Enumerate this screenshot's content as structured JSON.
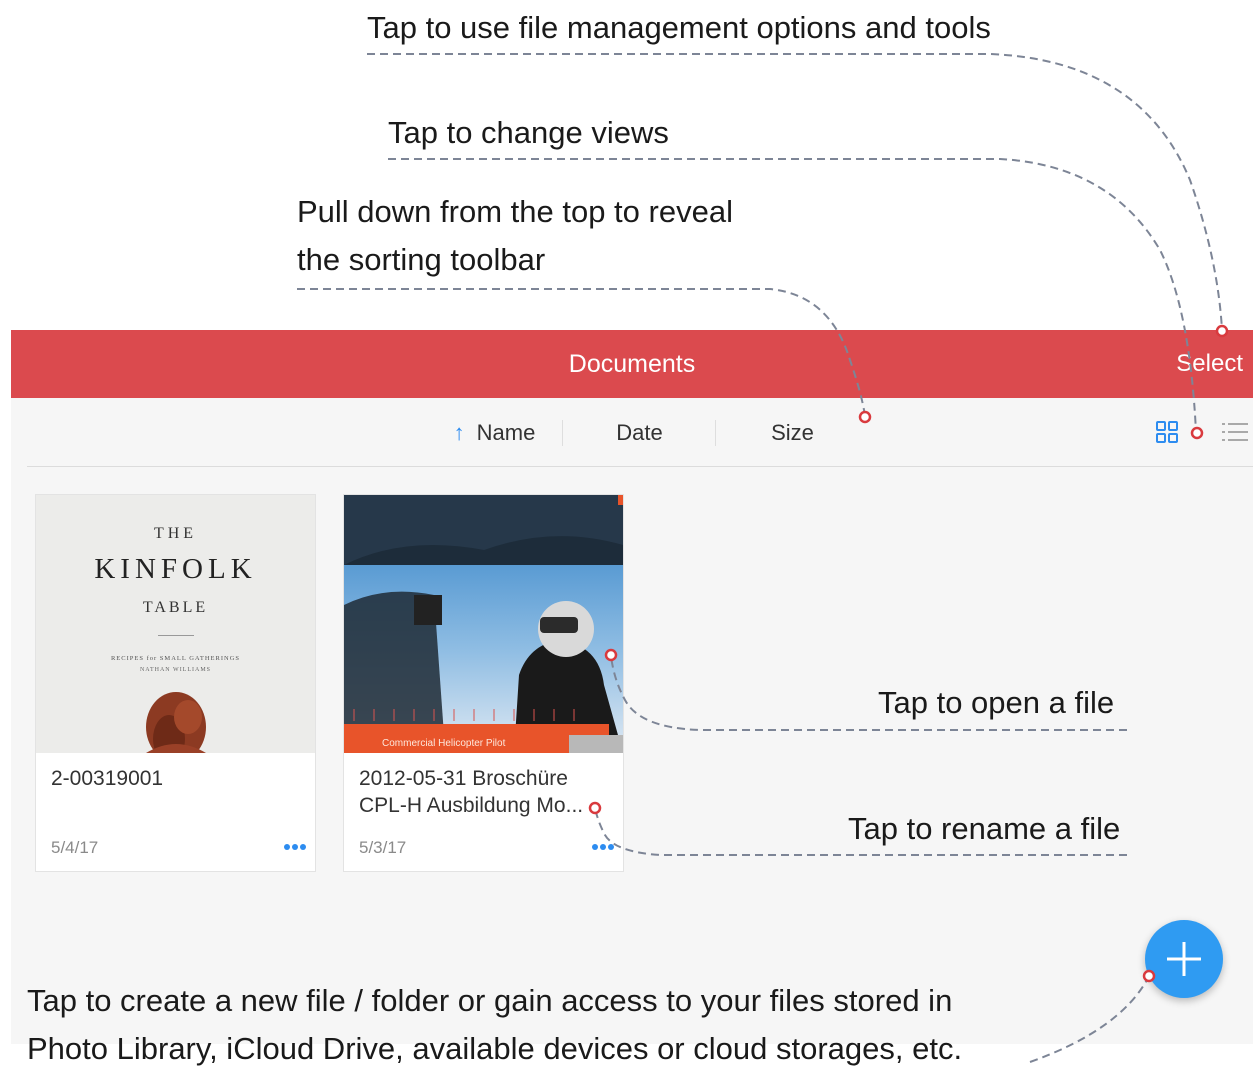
{
  "callouts": {
    "file_management": "Tap to use file management options and tools",
    "change_views": "Tap to change views",
    "sorting_line1": "Pull down from the top to reveal",
    "sorting_line2": "the sorting toolbar",
    "open_file": "Tap to open a file",
    "rename_file": "Tap to rename a file",
    "create_line1": "Tap to create a new file / folder or gain access to your files stored in",
    "create_line2": "Photo Library, iCloud Drive, available devices or cloud storages, etc."
  },
  "navbar": {
    "title": "Documents",
    "select_label": "Select",
    "color": "#db4a4e"
  },
  "sortbar": {
    "name_label": "Name",
    "date_label": "Date",
    "size_label": "Size",
    "sort_direction": "ascending",
    "active_view": "grid"
  },
  "files": [
    {
      "name": "2-00319001",
      "date": "5/4/17",
      "cover": {
        "line1": "THE",
        "line2": "KINFOLK",
        "line3": "TABLE",
        "subtitle": "RECIPES for SMALL GATHERINGS",
        "author": "NATHAN WILLIAMS"
      }
    },
    {
      "name": "2012-05-31 Broschüre\nCPL-H Ausbildung Mo...",
      "date": "5/3/17",
      "cover": {
        "banner": "Commercial Helicopter Pilot"
      }
    }
  ],
  "fab": {
    "icon": "plus-icon",
    "color": "#2f9bf2"
  },
  "accent_color": "#2d8cf0",
  "marker_color": "#d93a3e"
}
